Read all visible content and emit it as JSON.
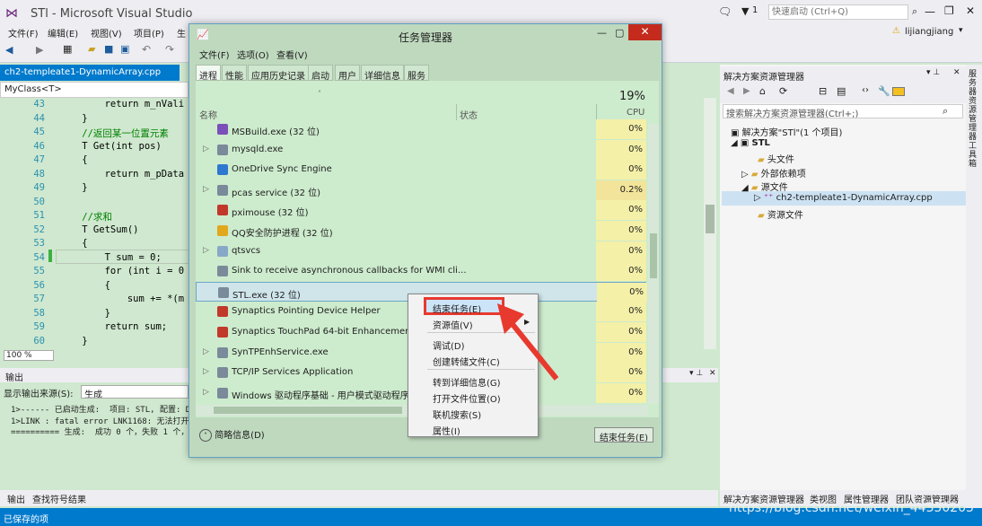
{
  "vs": {
    "title": "STl - Microsoft Visual Studio",
    "notifications": "1",
    "quick_launch_placeholder": "快速启动 (Ctrl+Q)",
    "user": "lijiangjiang",
    "menu": [
      "文件(F)",
      "编辑(E)",
      "视图(V)",
      "项目(P)",
      "生"
    ]
  },
  "editor": {
    "doc_tab": "ch2-templeate1-DynamicArray.cpp",
    "nav_class": "MyClass<T>",
    "line_numbers": [
      "43",
      "44",
      "45",
      "46",
      "47",
      "48",
      "49",
      "50",
      "51",
      "52",
      "53",
      "54",
      "55",
      "56",
      "57",
      "58",
      "59",
      "60"
    ],
    "lines": [
      "        return m_nVali",
      "    }",
      "    //返回某一位置元素",
      "    T Get(int pos)",
      "    {",
      "        return m_pData",
      "    }",
      "",
      "    //求和",
      "    T GetSum()",
      "    {",
      "        T sum = 0;",
      "        for (int i = 0",
      "        {",
      "            sum += *(m",
      "        }",
      "        return sum;",
      "    }"
    ],
    "zoom": "100 %"
  },
  "output": {
    "title": "输出",
    "source_label": "显示输出来源(S):",
    "source_value": "生成",
    "lines": [
      "1>------ 已启动生成:  项目: STL, 配置: De",
      "1>LINK : fatal error LNK1168: 无法打开 E:",
      "========== 生成:  成功 0 个，失败 1 个，"
    ],
    "tabs": [
      "输出",
      "查找符号结果"
    ]
  },
  "status": {
    "text": "已保存的项"
  },
  "watermark": "https://blog.csdn.net/weixin_44350205",
  "solution_explorer": {
    "title": "解决方案资源管理器",
    "search_placeholder": "搜索解决方案资源管理器(Ctrl+;)",
    "tree": [
      "解决方案\"STl\"(1 个项目)",
      "STL",
      "头文件",
      "外部依赖项",
      "源文件",
      "ch2-templeate1-DynamicArray.cpp",
      "资源文件"
    ],
    "bottom_tabs": [
      "解决方案资源管理器",
      "类视图",
      "属性管理器",
      "团队资源管理器"
    ],
    "side_strip": "服务器资源管理器  工具箱"
  },
  "task_manager": {
    "title": "任务管理器",
    "menu": [
      "文件(F)",
      "选项(O)",
      "查看(V)"
    ],
    "tabs": [
      "进程",
      "性能",
      "应用历史记录",
      "启动",
      "用户",
      "详细信息",
      "服务"
    ],
    "cpu_total": "19%",
    "columns": {
      "name": "名称",
      "status": "状态",
      "cpu": "CPU"
    },
    "processes": [
      {
        "name": "MSBuild.exe (32 位)",
        "cpu": "0%",
        "icon_color": "#7a4fb8",
        "expandable": false
      },
      {
        "name": "mysqld.exe",
        "cpu": "0%",
        "icon_color": "#7a8a9a",
        "expandable": true
      },
      {
        "name": "OneDrive Sync Engine",
        "cpu": "0%",
        "icon_color": "#2f78d0",
        "expandable": false
      },
      {
        "name": "pcas service (32 位)",
        "cpu": "0.2%",
        "icon_color": "#7a8a9a",
        "expandable": true
      },
      {
        "name": "pximouse (32 位)",
        "cpu": "0%",
        "icon_color": "#c0392b",
        "expandable": false
      },
      {
        "name": "QQ安全防护进程 (32 位)",
        "cpu": "0%",
        "icon_color": "#e1a81c",
        "expandable": false
      },
      {
        "name": "qtsvcs",
        "cpu": "0%",
        "icon_color": "#88a8c8",
        "expandable": true
      },
      {
        "name": "Sink to receive asynchronous callbacks for WMI cli...",
        "cpu": "0%",
        "icon_color": "#7a8a9a",
        "expandable": false
      },
      {
        "name": "STL.exe (32 位)",
        "cpu": "0%",
        "icon_color": "#7a8a9a",
        "expandable": false,
        "selected": true
      },
      {
        "name": "Synaptics Pointing Device Helper",
        "cpu": "0%",
        "icon_color": "#c0392b",
        "expandable": false
      },
      {
        "name": "Synaptics TouchPad 64-bit Enhancements",
        "cpu": "0%",
        "icon_color": "#c0392b",
        "expandable": false
      },
      {
        "name": "SynTPEnhService.exe",
        "cpu": "0%",
        "icon_color": "#7a8a9a",
        "expandable": true
      },
      {
        "name": "TCP/IP Services Application",
        "cpu": "0%",
        "icon_color": "#7a8a9a",
        "expandable": true
      },
      {
        "name": "Windows 驱动程序基础 - 用户模式驱动程序框",
        "cpu": "0%",
        "icon_color": "#7a8a9a",
        "expandable": true
      }
    ],
    "fewer_details": "简略信息(D)",
    "end_task_button": "结束任务(E)"
  },
  "context_menu": {
    "items": [
      "结束任务(E)",
      "资源值(V)",
      "调试(D)",
      "创建转储文件(C)",
      "转到详细信息(G)",
      "打开文件位置(O)",
      "联机搜索(S)",
      "属性(I)"
    ]
  },
  "colors": {
    "vs_blue": "#007acc",
    "editor_bg": "#cfe8cf",
    "highlight_red": "#e8392e",
    "cpu_yellow": "#f4f0a8"
  }
}
